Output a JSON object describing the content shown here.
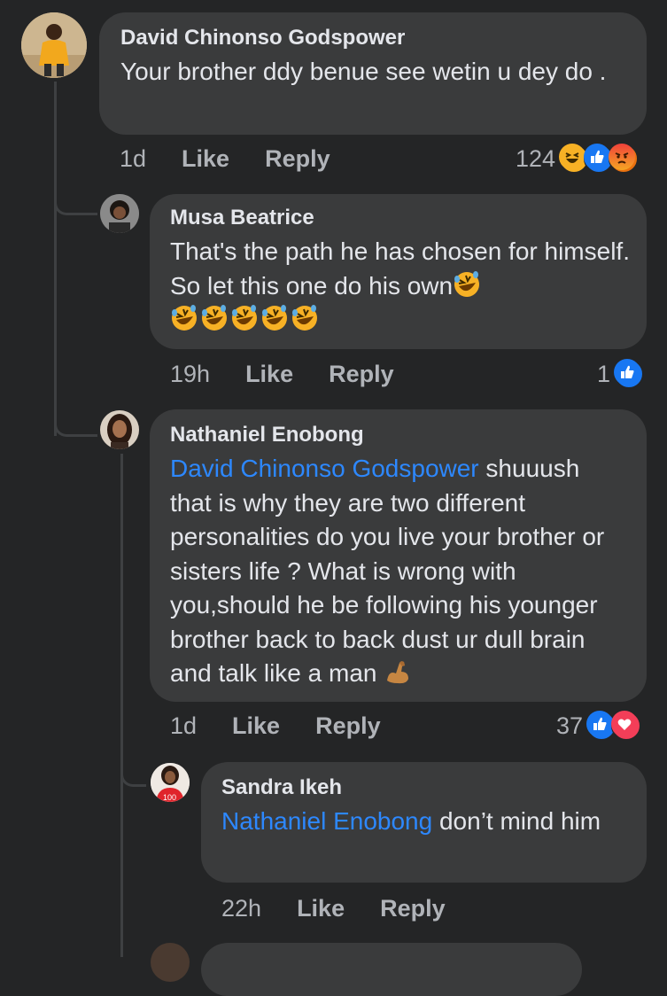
{
  "comments": [
    {
      "author": "David Chinonso Godspower",
      "text": "Your brother ddy benue see wetin u dey do .",
      "time": "1d",
      "like_label": "Like",
      "reply_label": "Reply",
      "reaction_count": "124",
      "reactions": [
        "haha-icon",
        "like-icon",
        "angry-icon"
      ]
    },
    {
      "author": "Musa Beatrice",
      "text": "That's the path he has chosen for himself. So let this one do his own",
      "emojis": [
        "rofl-emoji",
        "rofl-emoji",
        "rofl-emoji",
        "rofl-emoji",
        "rofl-emoji",
        "rofl-emoji"
      ],
      "time": "19h",
      "like_label": "Like",
      "reply_label": "Reply",
      "reaction_count": "1",
      "reactions": [
        "like-icon"
      ]
    },
    {
      "author": "Nathaniel Enobong",
      "mention": "David Chinonso Godspower",
      "text": " shuuush that is why they are two different personalities do you live your brother or sisters life ? What is wrong with you,should he be following his younger brother back to back  dust ur dull brain  and talk like a man ",
      "emojis": [
        "flexed-biceps-emoji"
      ],
      "time": "1d",
      "like_label": "Like",
      "reply_label": "Reply",
      "reaction_count": "37",
      "reactions": [
        "like-icon",
        "love-icon"
      ]
    },
    {
      "author": "Sandra Ikeh",
      "mention": "Nathaniel Enobong",
      "text": " don’t mind him",
      "time": "22h",
      "like_label": "Like",
      "reply_label": "Reply"
    }
  ],
  "colors": {
    "background": "#242526",
    "bubble": "#3a3b3c",
    "mention": "#2d88ff",
    "secondary_text": "#b0b3b8",
    "like_blue": "#1877f2",
    "love_red": "#f33e58",
    "haha_yellow": "#f7b125",
    "angry_orange": "#e9710f"
  }
}
